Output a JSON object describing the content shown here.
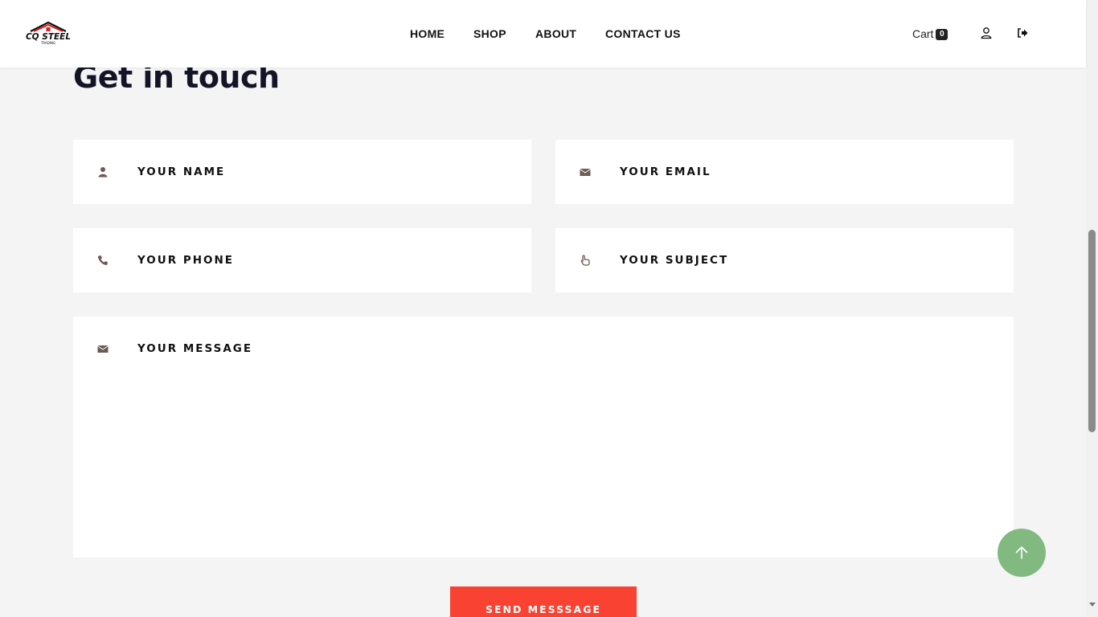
{
  "header": {
    "logo_text": "CQ STEEL",
    "logo_subtext": "TRADING",
    "nav": [
      {
        "label": "HOME"
      },
      {
        "label": "SHOP"
      },
      {
        "label": "ABOUT"
      },
      {
        "label": "CONTACT US"
      }
    ],
    "cart_label": "Cart",
    "cart_count": "0",
    "icons": [
      "user-icon",
      "sign-out-icon"
    ]
  },
  "main": {
    "title": "Get in touch",
    "fields": {
      "name": {
        "placeholder": "YOUR NAME",
        "icon": "user-icon"
      },
      "email": {
        "placeholder": "YOUR EMAIL",
        "icon": "envelope-icon"
      },
      "phone": {
        "placeholder": "YOUR PHONE",
        "icon": "phone-icon"
      },
      "subject": {
        "placeholder": "YOUR SUBJECT",
        "icon": "pointing-hand-icon"
      },
      "message": {
        "placeholder": "YOUR MESSAGE",
        "icon": "envelope-icon"
      }
    },
    "send_label": "SEND MESSSAGE"
  },
  "colors": {
    "accent": "#f94231",
    "to_top": "#82b981",
    "icon": "#6b5b55",
    "background": "#f4f4f4"
  }
}
